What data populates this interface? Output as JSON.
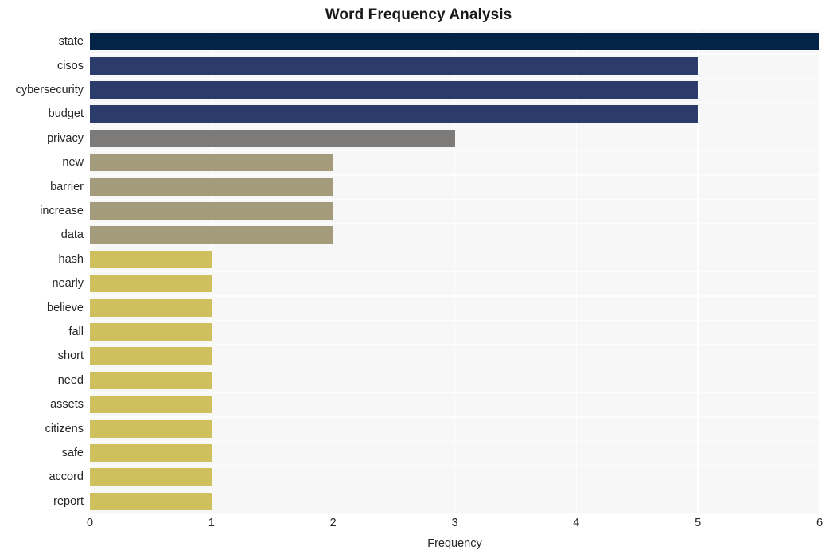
{
  "chart_data": {
    "type": "bar",
    "orientation": "horizontal",
    "title": "Word Frequency Analysis",
    "xlabel": "Frequency",
    "ylabel": "",
    "xlim": [
      0,
      6
    ],
    "xticks": [
      0,
      1,
      2,
      3,
      4,
      5,
      6
    ],
    "xticklabels": [
      "0",
      "1",
      "2",
      "3",
      "4",
      "5",
      "6"
    ],
    "grid": true,
    "grid_color": "#ffffff",
    "plot_background": "#f7f7f7",
    "figure_background": "#ffffff",
    "legend": null,
    "categories": [
      "state",
      "cisos",
      "cybersecurity",
      "budget",
      "privacy",
      "new",
      "barrier",
      "increase",
      "data",
      "hash",
      "nearly",
      "believe",
      "fall",
      "short",
      "need",
      "assets",
      "citizens",
      "safe",
      "accord",
      "report"
    ],
    "values": [
      6,
      5,
      5,
      5,
      3,
      2,
      2,
      2,
      2,
      1,
      1,
      1,
      1,
      1,
      1,
      1,
      1,
      1,
      1,
      1
    ],
    "bar_colors": [
      "#032347",
      "#2b3c6b",
      "#2b3c6b",
      "#2b3c6b",
      "#7c7b7a",
      "#a39b79",
      "#a39b79",
      "#a39b79",
      "#a39b79",
      "#cfc05e",
      "#cfc05e",
      "#cfc05e",
      "#cfc05e",
      "#cfc05e",
      "#cfc05e",
      "#cfc05e",
      "#cfc05e",
      "#cfc05e",
      "#cfc05e",
      "#cfc05e"
    ],
    "bars": [
      {
        "label": "state",
        "value": 6,
        "color": "#032347"
      },
      {
        "label": "cisos",
        "value": 5,
        "color": "#2b3c6b"
      },
      {
        "label": "cybersecurity",
        "value": 5,
        "color": "#2b3c6b"
      },
      {
        "label": "budget",
        "value": 5,
        "color": "#2b3c6b"
      },
      {
        "label": "privacy",
        "value": 3,
        "color": "#7c7b7a"
      },
      {
        "label": "new",
        "value": 2,
        "color": "#a39b79"
      },
      {
        "label": "barrier",
        "value": 2,
        "color": "#a39b79"
      },
      {
        "label": "increase",
        "value": 2,
        "color": "#a39b79"
      },
      {
        "label": "data",
        "value": 2,
        "color": "#a39b79"
      },
      {
        "label": "hash",
        "value": 1,
        "color": "#cfc05e"
      },
      {
        "label": "nearly",
        "value": 1,
        "color": "#cfc05e"
      },
      {
        "label": "believe",
        "value": 1,
        "color": "#cfc05e"
      },
      {
        "label": "fall",
        "value": 1,
        "color": "#cfc05e"
      },
      {
        "label": "short",
        "value": 1,
        "color": "#cfc05e"
      },
      {
        "label": "need",
        "value": 1,
        "color": "#cfc05e"
      },
      {
        "label": "assets",
        "value": 1,
        "color": "#cfc05e"
      },
      {
        "label": "citizens",
        "value": 1,
        "color": "#cfc05e"
      },
      {
        "label": "safe",
        "value": 1,
        "color": "#cfc05e"
      },
      {
        "label": "accord",
        "value": 1,
        "color": "#cfc05e"
      },
      {
        "label": "report",
        "value": 1,
        "color": "#cfc05e"
      }
    ]
  }
}
